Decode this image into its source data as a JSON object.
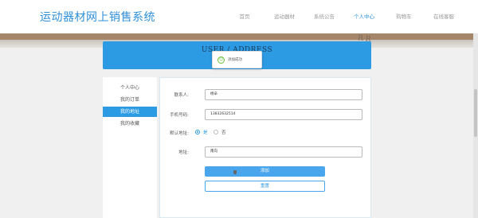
{
  "header": {
    "logo": "运动器材网上销售系统",
    "nav": [
      "首页",
      "运动器材",
      "系统公告",
      "个人中心",
      "购物车",
      "在线客服"
    ],
    "active_nav_index": 3
  },
  "banner": {
    "deco_text": "R R"
  },
  "page_title": "USER / ADDRESS",
  "toast": {
    "text": "添加成功"
  },
  "sidebar": {
    "items": [
      "个人中心",
      "我的订单",
      "我的地址",
      "我的收藏"
    ],
    "active_index": 2
  },
  "form": {
    "contact_label": "联系人:",
    "contact_value": "杨辛",
    "phone_label": "手机号码:",
    "phone_value": "13832632514",
    "default_label": "默认地址:",
    "default_yes": "是",
    "default_no": "否",
    "default_selected": "是",
    "address_label": "地址:",
    "address_value": "南向",
    "submit_label": "添加",
    "reset_label": "重置"
  },
  "colors": {
    "primary": "#2c9be3",
    "logo": "#2e8fd8",
    "banner": "#a5866a"
  }
}
